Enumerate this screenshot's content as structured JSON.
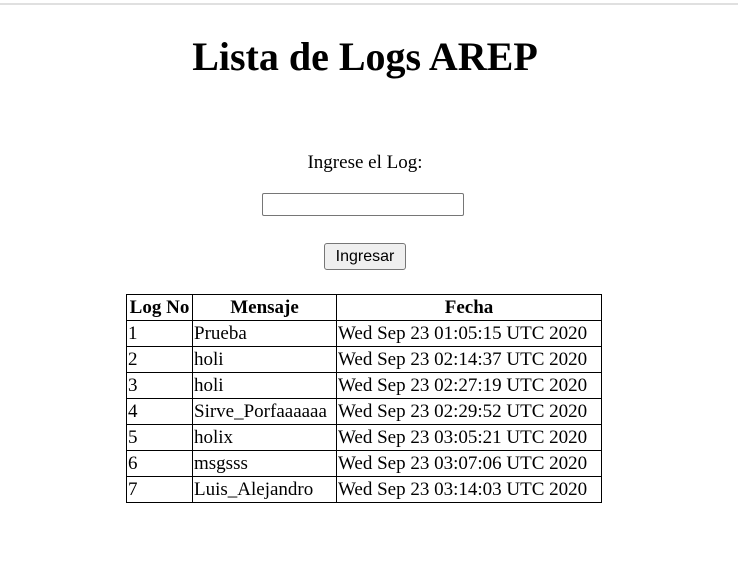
{
  "page": {
    "title": "Lista de Logs AREP"
  },
  "form": {
    "label": "Ingrese el Log:",
    "input_value": "",
    "input_placeholder": "",
    "submit_label": "Ingresar"
  },
  "table": {
    "headers": [
      "Log No",
      "Mensaje",
      "Fecha"
    ],
    "rows": [
      [
        "1",
        "Prueba",
        "Wed Sep 23 01:05:15 UTC 2020"
      ],
      [
        "2",
        "holi",
        "Wed Sep 23 02:14:37 UTC 2020"
      ],
      [
        "3",
        "holi",
        "Wed Sep 23 02:27:19 UTC 2020"
      ],
      [
        "4",
        "Sirve_Porfaaaaaa",
        "Wed Sep 23 02:29:52 UTC 2020"
      ],
      [
        "5",
        "holix",
        "Wed Sep 23 03:05:21 UTC 2020"
      ],
      [
        "6",
        "msgsss",
        "Wed Sep 23 03:07:06 UTC 2020"
      ],
      [
        "7",
        "Luis_Alejandro",
        "Wed Sep 23 03:14:03 UTC 2020"
      ]
    ]
  }
}
